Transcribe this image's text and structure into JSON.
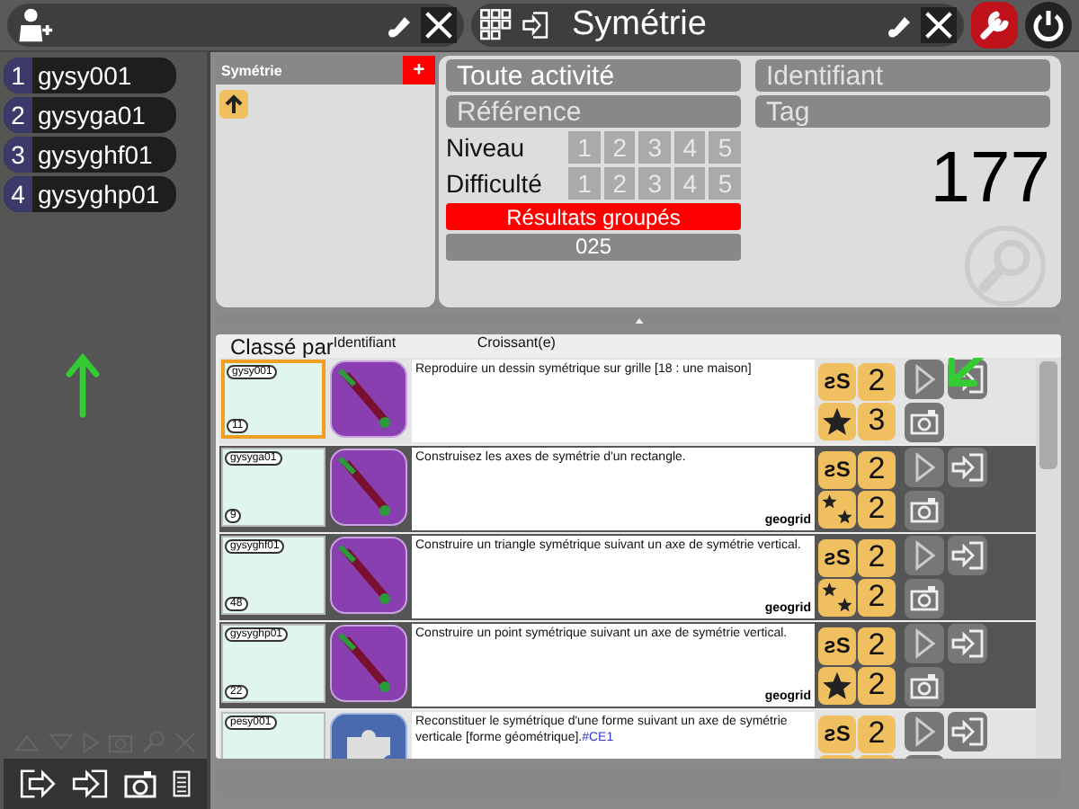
{
  "topbar": {
    "title": "Symétrie"
  },
  "sidebar": {
    "items": [
      {
        "number": "1",
        "label": "gysy001"
      },
      {
        "number": "2",
        "label": "gysyga01"
      },
      {
        "number": "3",
        "label": "gysyghf01"
      },
      {
        "number": "4",
        "label": "gysyghp01"
      }
    ]
  },
  "tree": {
    "title": "Symétrie",
    "add": "+"
  },
  "filters": {
    "activity": "Toute activité",
    "reference_placeholder": "Référence",
    "identifier_placeholder": "Identifiant",
    "tag_placeholder": "Tag",
    "level_label": "Niveau",
    "difficulty_label": "Difficulté",
    "levels": [
      "1",
      "2",
      "3",
      "4",
      "5"
    ],
    "difficulties": [
      "1",
      "2",
      "3",
      "4",
      "5"
    ],
    "grouped": "Résultats groupés",
    "count_code": "025",
    "total": "177"
  },
  "sort": {
    "label": "Classé par",
    "field": "Identifiant",
    "order": "Croissant(e)"
  },
  "rows": [
    {
      "thumb_id": "gysy001",
      "thumb_count": "11",
      "kind": "compass",
      "description": "Reproduire un dessin symétrique sur grille [18 : une maison]",
      "domain": "ƨS",
      "level": "2",
      "star_badge": {
        "kind": "single"
      },
      "difficulty": "3",
      "selected": false,
      "current": true
    },
    {
      "thumb_id": "gysyga01",
      "thumb_count": "9",
      "kind": "compass",
      "description": "Construisez les axes de symétrie d'un rectangle.",
      "author": "geogrid",
      "domain": "ƨS",
      "level": "2",
      "star_badge": {
        "kind": "double"
      },
      "difficulty": "2",
      "selected": true,
      "current": false
    },
    {
      "thumb_id": "gysyghf01",
      "thumb_count": "48",
      "kind": "compass",
      "description": "Construire un triangle symétrique suivant un axe de symétrie vertical.",
      "author": "geogrid",
      "domain": "ƨS",
      "level": "2",
      "star_badge": {
        "kind": "double"
      },
      "difficulty": "2",
      "selected": true,
      "current": false
    },
    {
      "thumb_id": "gysyghp01",
      "thumb_count": "22",
      "kind": "compass",
      "description": "Construire un point symétrique suivant un axe de symétrie vertical.",
      "author": "geogrid",
      "domain": "ƨS",
      "level": "2",
      "star_badge": {
        "kind": "single"
      },
      "difficulty": "2",
      "selected": true,
      "current": false
    },
    {
      "thumb_id": "pesy001",
      "kind": "puzzle",
      "description": "Reconstituer le symétrique d'une forme suivant un axe de symétrie verticale [forme géométrique].",
      "tag": "#CE1",
      "domain": "ƨS",
      "level": "2",
      "selected": false,
      "current": false
    }
  ]
}
